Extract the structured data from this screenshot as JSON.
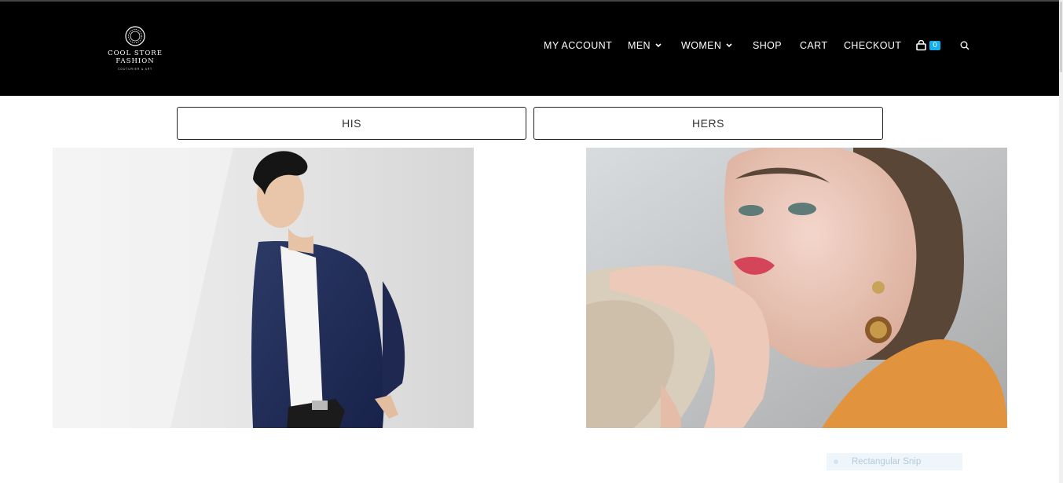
{
  "logo": {
    "line1": "COOL STORE",
    "line2": "FASHION",
    "tagline": "COUTURIER & ART"
  },
  "nav": {
    "items": [
      {
        "label": "MY ACCOUNT",
        "has_dropdown": false
      },
      {
        "label": "MEN",
        "has_dropdown": true
      },
      {
        "label": "WOMEN",
        "has_dropdown": true
      },
      {
        "label": "SHOP",
        "has_dropdown": false
      },
      {
        "label": "CART",
        "has_dropdown": false
      },
      {
        "label": "CHECKOUT",
        "has_dropdown": false
      }
    ],
    "cart_count": "0",
    "icons": [
      "shopping-bag-icon",
      "search-icon",
      "chevron-down-icon"
    ]
  },
  "tabs": {
    "his_label": "HIS",
    "hers_label": "HERS"
  },
  "overlay": {
    "snip_label": "Rectangular Snip"
  },
  "colors": {
    "header_bg": "#000000",
    "accent": "#13aff0",
    "text_dark": "#333333",
    "button_border": "#222222"
  }
}
